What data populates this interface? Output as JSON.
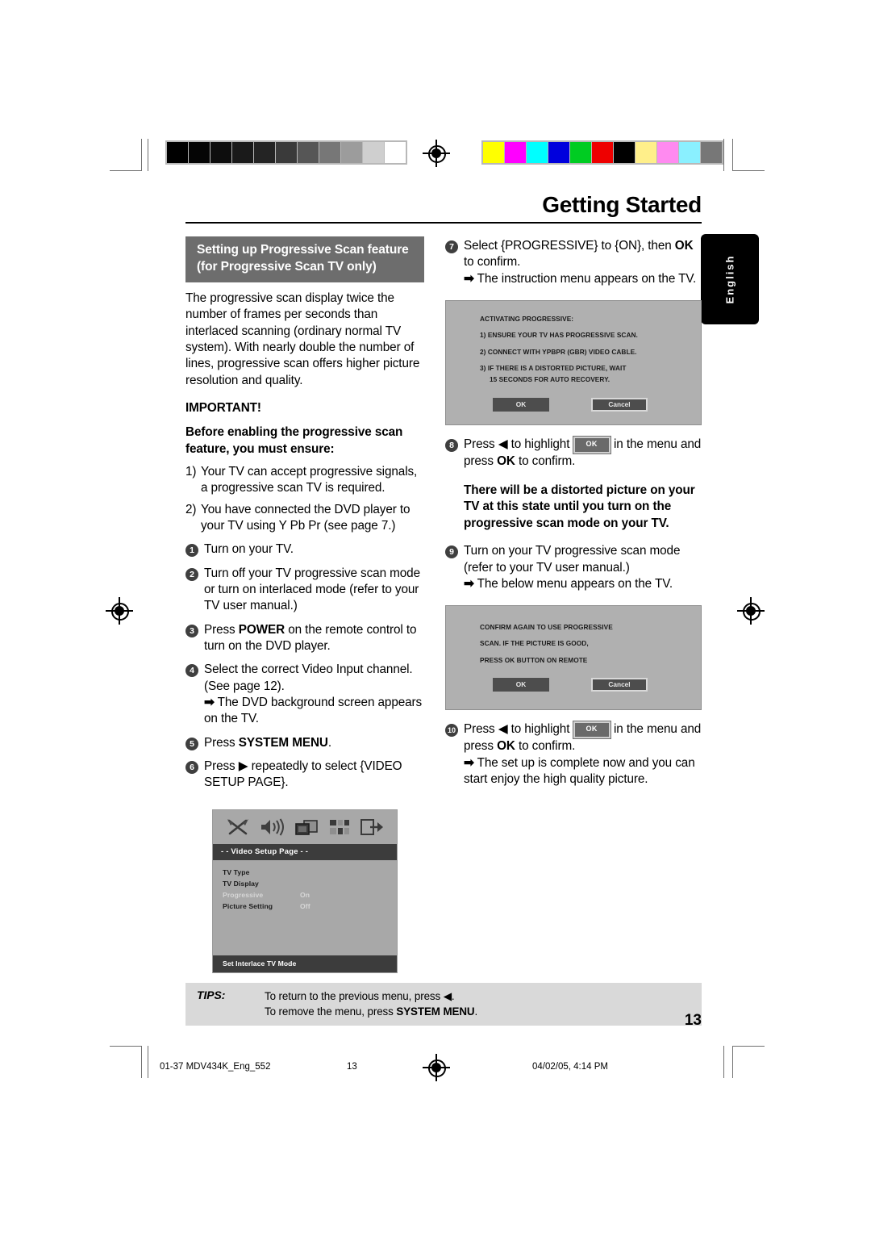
{
  "header": {
    "title": "Getting Started"
  },
  "language_tab": {
    "label": "English"
  },
  "left_column": {
    "section_title_line1": "Setting up Progressive Scan feature",
    "section_title_line2": "(for Progressive Scan TV only)",
    "intro": "The progressive scan display twice the number of frames per seconds than interlaced scanning (ordinary normal TV system). With nearly double the number of lines, progressive scan offers higher picture resolution and quality.",
    "important_heading": "IMPORTANT!",
    "important_text": "Before enabling the progressive scan feature, you must ensure:",
    "requirements": [
      {
        "num": "1)",
        "text": "Your TV can accept progressive signals, a progressive scan TV is required."
      },
      {
        "num": "2)",
        "text": "You have connected the DVD player to your TV using Y Pb Pr (see page 7.)"
      }
    ],
    "steps": [
      {
        "num": "1",
        "text": "Turn on your TV."
      },
      {
        "num": "2",
        "text": "Turn off your TV progressive scan mode or turn on interlaced mode (refer to your TV user manual.)"
      },
      {
        "num": "3",
        "pre": "Press ",
        "bold": "POWER",
        "post": " on the remote control to turn on the DVD player."
      },
      {
        "num": "4",
        "text": "Select the correct Video Input channel. (See page 12).",
        "arrow": "The DVD background screen appears on the TV."
      },
      {
        "num": "5",
        "pre": "Press ",
        "bold": "SYSTEM MENU",
        "post": "."
      },
      {
        "num": "6",
        "text": "Press ▶ repeatedly to select {VIDEO SETUP PAGE}."
      }
    ]
  },
  "dvd_menu": {
    "icons": [
      "tools-icon",
      "speaker-icon",
      "video-icon",
      "preference-icon",
      "exit-icon"
    ],
    "title": "- -  Video Setup Page  - -",
    "rows": [
      {
        "label": "TV Type",
        "value": "",
        "dim": false
      },
      {
        "label": "TV Display",
        "value": "",
        "dim": false
      },
      {
        "label": "Progressive",
        "value": "On",
        "dim": true
      },
      {
        "label": "Picture Setting",
        "value": "Off",
        "dim": false
      }
    ],
    "status": "Set Interlace TV Mode"
  },
  "right_column": {
    "steps": [
      {
        "num": "7",
        "pre": "Select {PROGRESSIVE} to {ON}, then ",
        "bold": "OK",
        "post": " to confirm.",
        "arrow": "The instruction menu appears on the TV."
      },
      {
        "num": "8",
        "seg_a": "Press ◀ to highlight ",
        "key": "OK",
        "seg_b": " in the menu and press ",
        "bold": "OK",
        "seg_c": " to confirm."
      },
      {
        "num": "9",
        "text": "Turn on your TV progressive scan mode (refer to your TV user manual.)",
        "arrow": "The below menu appears on the TV."
      },
      {
        "num": "10",
        "seg_a": "Press ◀ to highlight ",
        "key": "OK",
        "seg_b": " in the menu and press ",
        "bold": "OK",
        "seg_c": " to confirm.",
        "arrow": "The set up is complete now and you can start enjoy the high quality picture."
      }
    ],
    "warning": "There will be a distorted picture on your TV at this state until you turn on the progressive scan mode on your TV.",
    "dialog_1": {
      "title": "ACTIVATING PROGRESSIVE:",
      "lines": [
        "1) ENSURE YOUR TV HAS PROGRESSIVE SCAN.",
        "2) CONNECT WITH YPBPR (GBR) VIDEO CABLE.",
        "3) IF THERE IS A DISTORTED PICTURE, WAIT",
        "15 SECONDS FOR AUTO RECOVERY."
      ],
      "ok_label": "OK",
      "cancel_label": "Cancel"
    },
    "dialog_2": {
      "lines": [
        "CONFIRM AGAIN TO USE PROGRESSIVE",
        "SCAN.  IF THE PICTURE IS GOOD,",
        "PRESS OK BUTTON ON REMOTE"
      ],
      "ok_label": "OK",
      "cancel_label": "Cancel"
    }
  },
  "tips": {
    "label": "TIPS:",
    "line1": "To return to the previous menu, press ◀.",
    "line2_pre": "To remove the menu, press ",
    "line2_bold": "SYSTEM MENU",
    "line2_post": "."
  },
  "page_number": "13",
  "footer": {
    "file": "01-37 MDV434K_Eng_552",
    "page": "13",
    "date": "04/02/05, 4:14 PM"
  },
  "calibration": {
    "gray_bar": [
      "#000000",
      "#050505",
      "#0d0d0d",
      "#1a1a1a",
      "#242424",
      "#3a3a3a",
      "#565656",
      "#777777",
      "#9c9c9c",
      "#cfcfcf",
      "#ffffff"
    ],
    "color_bar": [
      "#ffff00",
      "#ff00ff",
      "#00ffff",
      "#0000dd",
      "#00cc22",
      "#ee0000",
      "#000000",
      "#ffef8a",
      "#ff8af0",
      "#8af0ff",
      "#777777"
    ]
  }
}
